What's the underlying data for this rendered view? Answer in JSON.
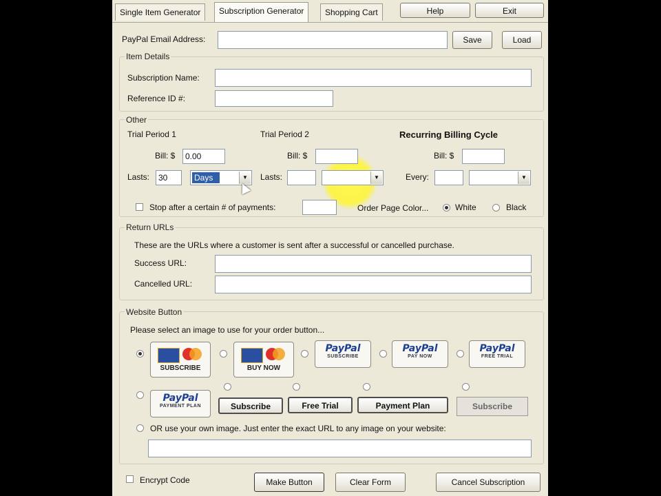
{
  "tabs": [
    "Single Item Generator",
    "Subscription Generator",
    "Shopping Cart"
  ],
  "top_buttons": {
    "help": "Help",
    "exit": "Exit"
  },
  "email": {
    "label": "PayPal Email Address:",
    "value": "",
    "save": "Save",
    "load": "Load"
  },
  "item_details": {
    "title": "Item Details",
    "subscription_name_label": "Subscription Name:",
    "reference_id_label": "Reference ID #:"
  },
  "other": {
    "title": "Other",
    "trial1": {
      "title": "Trial Period 1",
      "bill_label": "Bill: $",
      "bill_value": "0.00",
      "lasts_label": "Lasts:",
      "lasts_value": "30",
      "unit_value": "Days"
    },
    "trial2": {
      "title": "Trial Period 2",
      "bill_label": "Bill: $",
      "lasts_label": "Lasts:"
    },
    "recurring": {
      "title": "Recurring Billing Cycle",
      "bill_label": "Bill: $",
      "every_label": "Every:"
    },
    "stop_label": "Stop after a certain # of payments:",
    "order_color_label": "Order Page Color...",
    "white_label": "White",
    "black_label": "Black"
  },
  "return_urls": {
    "title": "Return URLs",
    "description": "These are the URLs where a customer is sent after a successful or cancelled purchase.",
    "success_label": "Success URL:",
    "cancelled_label": "Cancelled URL:"
  },
  "website_button": {
    "title": "Website Button",
    "instruction": "Please select an image to use for your order button...",
    "card_subscribe": "SUBSCRIBE",
    "card_buy_now": "BUY NOW",
    "paypal_logo": "PayPal",
    "pp_subscribe": "SUBSCRIBE",
    "pp_pay_now": "PAY NOW",
    "pp_free_trial": "FREE TRIAL",
    "pp_payment_plan": "PAYMENT PLAN",
    "text_subscribe": "Subscribe",
    "text_free_trial": "Free Trial",
    "text_payment_plan": "Payment Plan",
    "text_subscribe_flat": "Subscribe",
    "own_image_label": "OR use your own image. Just enter the exact URL to any image on your website:"
  },
  "bottom": {
    "encrypt_label": "Encrypt Code",
    "make_button": "Make Button",
    "clear_form": "Clear Form",
    "cancel_subscription": "Cancel Subscription"
  }
}
